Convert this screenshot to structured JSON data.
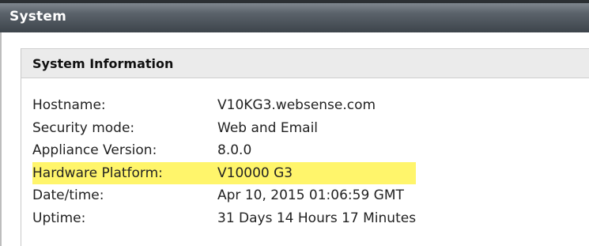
{
  "header": {
    "title": "System"
  },
  "system_information": {
    "title": "System Information",
    "rows": [
      {
        "label": "Hostname:",
        "value": "V10KG3.websense.com",
        "highlighted": false
      },
      {
        "label": "Security mode:",
        "value": "Web and Email",
        "highlighted": false
      },
      {
        "label": "Appliance Version:",
        "value": "8.0.0",
        "highlighted": false
      },
      {
        "label": "Hardware Platform:",
        "value": "V10000 G3",
        "highlighted": true
      },
      {
        "label": "Date/time:",
        "value": "Apr 10, 2015 01:06:59 GMT",
        "highlighted": false
      },
      {
        "label": "Uptime:",
        "value": "31 Days 14 Hours 17 Minutes",
        "highlighted": false
      }
    ]
  },
  "colors": {
    "header_bar": "#4a5158",
    "section_header_bg": "#ebebeb",
    "highlight": "#fff56b"
  }
}
